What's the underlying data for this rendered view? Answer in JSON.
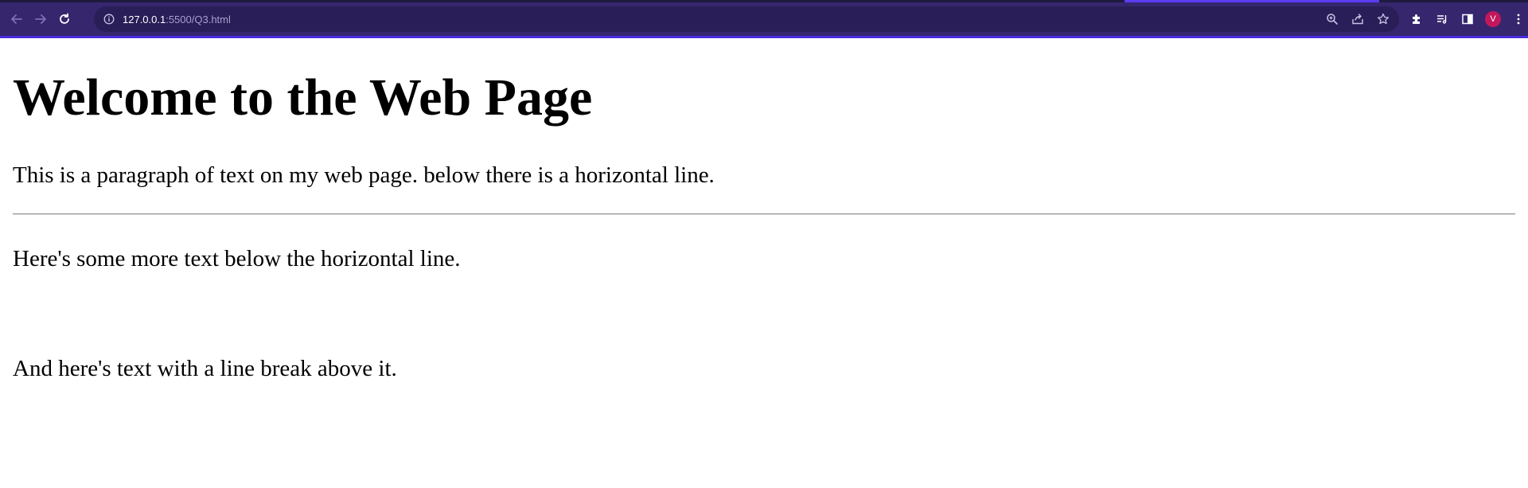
{
  "browser": {
    "url_host": "127.0.0.1",
    "url_rest": ":5500/Q3.html",
    "avatar_letter": "V",
    "theme_color": "#35266e",
    "avatar_color": "#c2185b"
  },
  "page": {
    "heading": "Welcome to the Web Page",
    "paragraph1": "This is a paragraph of text on my web page. below there is a horizontal line.",
    "paragraph2": "Here's some more text below the horizontal line.",
    "paragraph3": "And here's text with a line break above it."
  },
  "icons": {
    "back": "back-arrow-icon",
    "forward": "forward-arrow-icon",
    "reload": "reload-icon",
    "info": "info-icon",
    "zoom": "zoom-icon",
    "share": "share-icon",
    "bookmark": "star-icon",
    "extensions": "puzzle-icon",
    "reading_list": "reading-list-icon",
    "side_panel": "side-panel-icon",
    "menu": "kebab-menu-icon"
  }
}
